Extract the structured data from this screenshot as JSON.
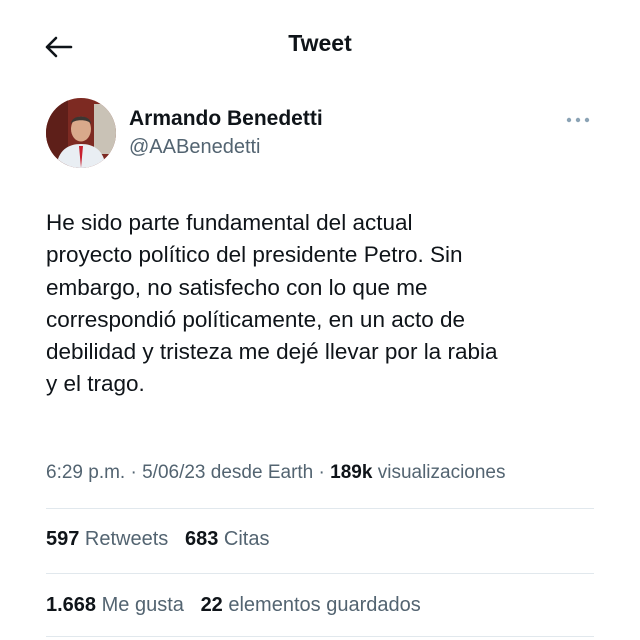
{
  "header": {
    "title": "Tweet",
    "back_icon": "arrow-left-icon"
  },
  "author": {
    "name": "Armando Benedetti",
    "handle": "@AABenedetti",
    "more_icon": "more-dots-icon"
  },
  "tweet": {
    "lines": [
      "He sido parte fundamental del actual",
      "proyecto político del presidente Petro. Sin",
      "embargo, no satisfecho con lo que me",
      "correspondió políticamente, en un acto de",
      "debilidad y tristeza me dejé llevar por la rabia",
      "y el trago."
    ]
  },
  "meta": {
    "time": "6:29 p.m.",
    "sep1": " · ",
    "date": "5/06/23",
    "source": " desde Earth",
    "sep2": " · ",
    "views_count": "189k",
    "views_label": " visualizaciones"
  },
  "stats": {
    "retweets_count": "597",
    "retweets_label": " Retweets",
    "quotes_count": "683",
    "quotes_label": " Citas",
    "likes_count": "1.668",
    "likes_label": " Me gusta",
    "bookmarks_count": "22",
    "bookmarks_label": " elementos guardados"
  },
  "colors": {
    "text": "#0f1419",
    "secondary": "#536471",
    "divider": "#e1e8ed",
    "more_dots": "#8ba3b5"
  }
}
